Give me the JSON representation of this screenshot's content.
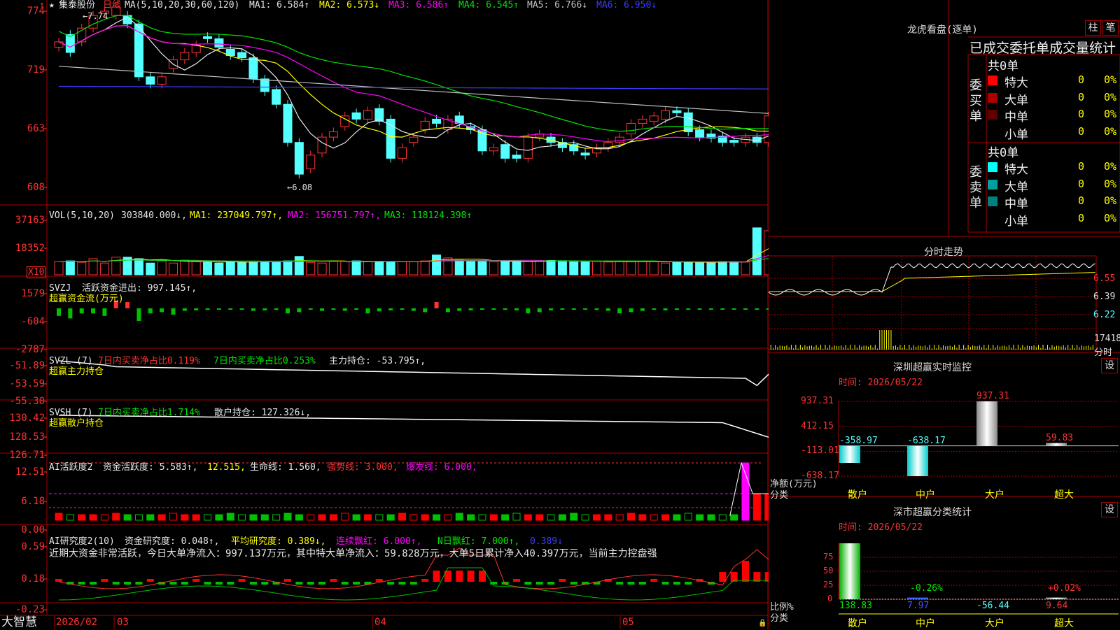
{
  "app": {
    "brand": "大智慧"
  },
  "price_panel": {
    "stock_name": "集泰股份",
    "period": "日线",
    "ma_params": "MA(5,10,20,30,60,120)",
    "ma1": "MA1: 6.584↑",
    "ma2": "MA2: 6.573↓",
    "ma3": "MA3: 6.586↑",
    "ma4": "MA4: 6.545↑",
    "ma5": "MA5: 6.766↓",
    "ma6": "MA6: 6.950↓",
    "high_note": "7.74",
    "low_note": "6.08",
    "y_labels": [
      "774",
      "719",
      "663",
      "608"
    ]
  },
  "vol_panel": {
    "title": "VOL(5,10,20)",
    "value": "303840.000↓,",
    "ma1": "MA1: 237049.797↑,",
    "ma2": "MA2: 156751.797↑,",
    "ma3": "MA3: 118124.398↑",
    "y_labels": [
      "37163",
      "18352"
    ],
    "unit": "X10"
  },
  "svzj_panel": {
    "title": "SVZJ",
    "value": "活跃资金进出: 997.145↑,",
    "name": "超赢资金流(万元)",
    "y_labels": [
      "1579",
      "-604",
      "-2787"
    ]
  },
  "svzl_panel": {
    "title": "SVZL (7)",
    "item1": "7日内买卖净占比0.119%",
    "item2": "7日内买卖净占比0.253%",
    "value": "主力持仓: -53.795↑,",
    "name": "超赢主力持仓",
    "y_labels": [
      "-51.89",
      "-53.59",
      "-55.30"
    ]
  },
  "svsh_panel": {
    "title": "SVSH (7)",
    "item1": "7日内买卖净占比1.714%",
    "value": "散户持仓: 127.326↓,",
    "name": "超赢散户持仓",
    "y_labels": [
      "130.42",
      "128.53",
      "126.71"
    ]
  },
  "ai_active_panel": {
    "title": "AI活跃度2",
    "value": "资金活跃度: 5.583↑,",
    "v2": "12.515,",
    "life": "生命线: 1.560,",
    "strong": "强势线: 3.000,",
    "burst": "爆发线: 6.000,",
    "y_labels": [
      "12.51",
      "6.18",
      "0.00"
    ]
  },
  "ai_research_panel": {
    "title": "AI研究度2(10)",
    "value": "资金研究度: 0.048↑,",
    "avg": "平均研究度: 0.389↓,",
    "cont": "连续飘红: 6.000↑,",
    "nday": "N日飘红: 7.000↑,",
    "last": "0.389↓",
    "summary": "近期大资金非常活跃，今日大单净流入：997.137万元，其中特大单净流入：59.828万元，大单5日累计净入40.397万元，当前主力控盘强",
    "y_labels": [
      "0.59",
      "0.18",
      "-0.23"
    ]
  },
  "x_axis": {
    "labels": [
      "2026/02",
      "03",
      "04",
      "05"
    ]
  },
  "right_panel": {
    "lhb_title": "龙虎看盘(逐单)",
    "btn_zhu": "柱",
    "btn_bi": "笔",
    "order_title": "已成交委托单成交量统计",
    "buy": {
      "label": "委买单",
      "total": "共0单",
      "rows": [
        {
          "name": "特大",
          "count": "0",
          "pct": "0%",
          "color": "#ff0000"
        },
        {
          "name": "大单",
          "count": "0",
          "pct": "0%",
          "color": "#aa0000"
        },
        {
          "name": "中单",
          "count": "0",
          "pct": "0%",
          "color": "#600000"
        },
        {
          "name": "小单",
          "count": "0",
          "pct": "0%",
          "color": "#000000"
        }
      ]
    },
    "sell": {
      "label": "委卖单",
      "total": "共0单",
      "rows": [
        {
          "name": "特大",
          "count": "0",
          "pct": "0%",
          "color": "#00ffff"
        },
        {
          "name": "大单",
          "count": "0",
          "pct": "0%",
          "color": "#00a0a0"
        },
        {
          "name": "中单",
          "count": "0",
          "pct": "0%",
          "color": "#008080"
        },
        {
          "name": "小单",
          "count": "0",
          "pct": "0%",
          "color": "#000000"
        }
      ]
    },
    "intraday": {
      "title": "分时走势",
      "y_labels": [
        "6.55",
        "6.39",
        "6.22"
      ],
      "vol_label": "17418",
      "unit": "分时"
    },
    "sz_monitor": {
      "title": "深圳超赢实时监控",
      "btn": "设",
      "time": "时间: 2026/05/22",
      "y_labels": [
        "937.31",
        "412.15",
        "-113.01",
        "-638.17"
      ],
      "legend1": "净额(万元)",
      "legend2": "分类",
      "categories": [
        "散户",
        "中户",
        "大户",
        "超大"
      ],
      "values": [
        -358.97,
        -638.17,
        937.31,
        59.83
      ],
      "value_labels": [
        "-358.97",
        "-638.17",
        "937.31",
        "59.83"
      ]
    },
    "sz_class": {
      "title": "深市超赢分类统计",
      "btn": "设",
      "time": "时间: 2026/05/22",
      "y_labels": [
        "75",
        "50",
        "25",
        "0"
      ],
      "legend1": "比例%",
      "legend2": "分类",
      "categories": [
        "散户",
        "中户",
        "大户",
        "超大"
      ],
      "bar_labels": [
        "-0.26%",
        "+0.02%"
      ],
      "bottom_values": [
        "138.83",
        "7.97",
        "-56.44",
        "9.64"
      ]
    }
  },
  "colors": {
    "up": "#ff3232",
    "down": "#54ffff",
    "grid": "#aa0000",
    "ma1": "#e6e6e6",
    "ma2": "#ffff00",
    "ma3": "#ff00ff",
    "ma4": "#00e600",
    "ma5": "#c0c0c0",
    "ma6": "#3c3cff"
  }
}
